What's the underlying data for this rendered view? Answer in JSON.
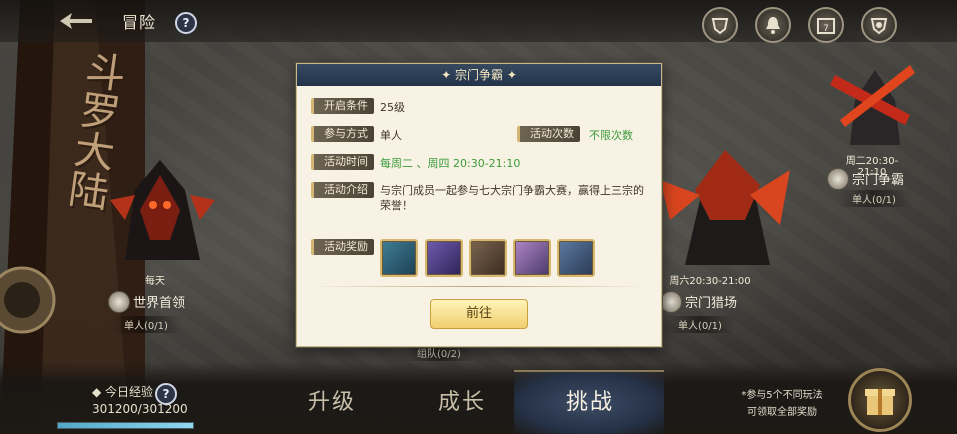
{
  "header": {
    "title": "冒险",
    "help": "?"
  },
  "banner": {
    "text": "斗罗大陆"
  },
  "cards": [
    {
      "time": "每天",
      "name": "世界首领",
      "sub": "单人(0/1)"
    },
    {
      "time": "",
      "name": "",
      "sub": "组队(0/2)"
    },
    {
      "time": "周六20:30-21:00",
      "name": "宗门猎场",
      "sub": "单人(0/1)"
    },
    {
      "time": "周二20:30-21:10",
      "name": "宗门争霸",
      "sub": "单人(0/1)"
    }
  ],
  "modal": {
    "title": "宗门争霸",
    "rows": {
      "open_label": "开启条件",
      "open_value": "25级",
      "mode_label": "参与方式",
      "mode_value": "单人",
      "times_label": "活动次数",
      "times_value": "不限次数",
      "time_label": "活动时间",
      "time_value": "每周二 、周四  20:30-21:10",
      "intro_label": "活动介绍",
      "intro_value": "与宗门成员一起参与七大宗门争霸大赛，赢得上三宗的荣誉！",
      "reward_label": "活动奖励"
    },
    "go_button": "前往",
    "reward_colors": [
      "#2e5d74",
      "#4b3a7c",
      "#5b4a3c",
      "#7a5a7a",
      "#3a4d66"
    ]
  },
  "bottom": {
    "exp_label": "今日经验",
    "exp_value": "301200/301200",
    "exp_progress": 1.0,
    "tabs": [
      "升级",
      "成长",
      "挑战"
    ],
    "hint_line1": "*参与5个不同玩法",
    "hint_line2": "可领取全部奖励"
  }
}
